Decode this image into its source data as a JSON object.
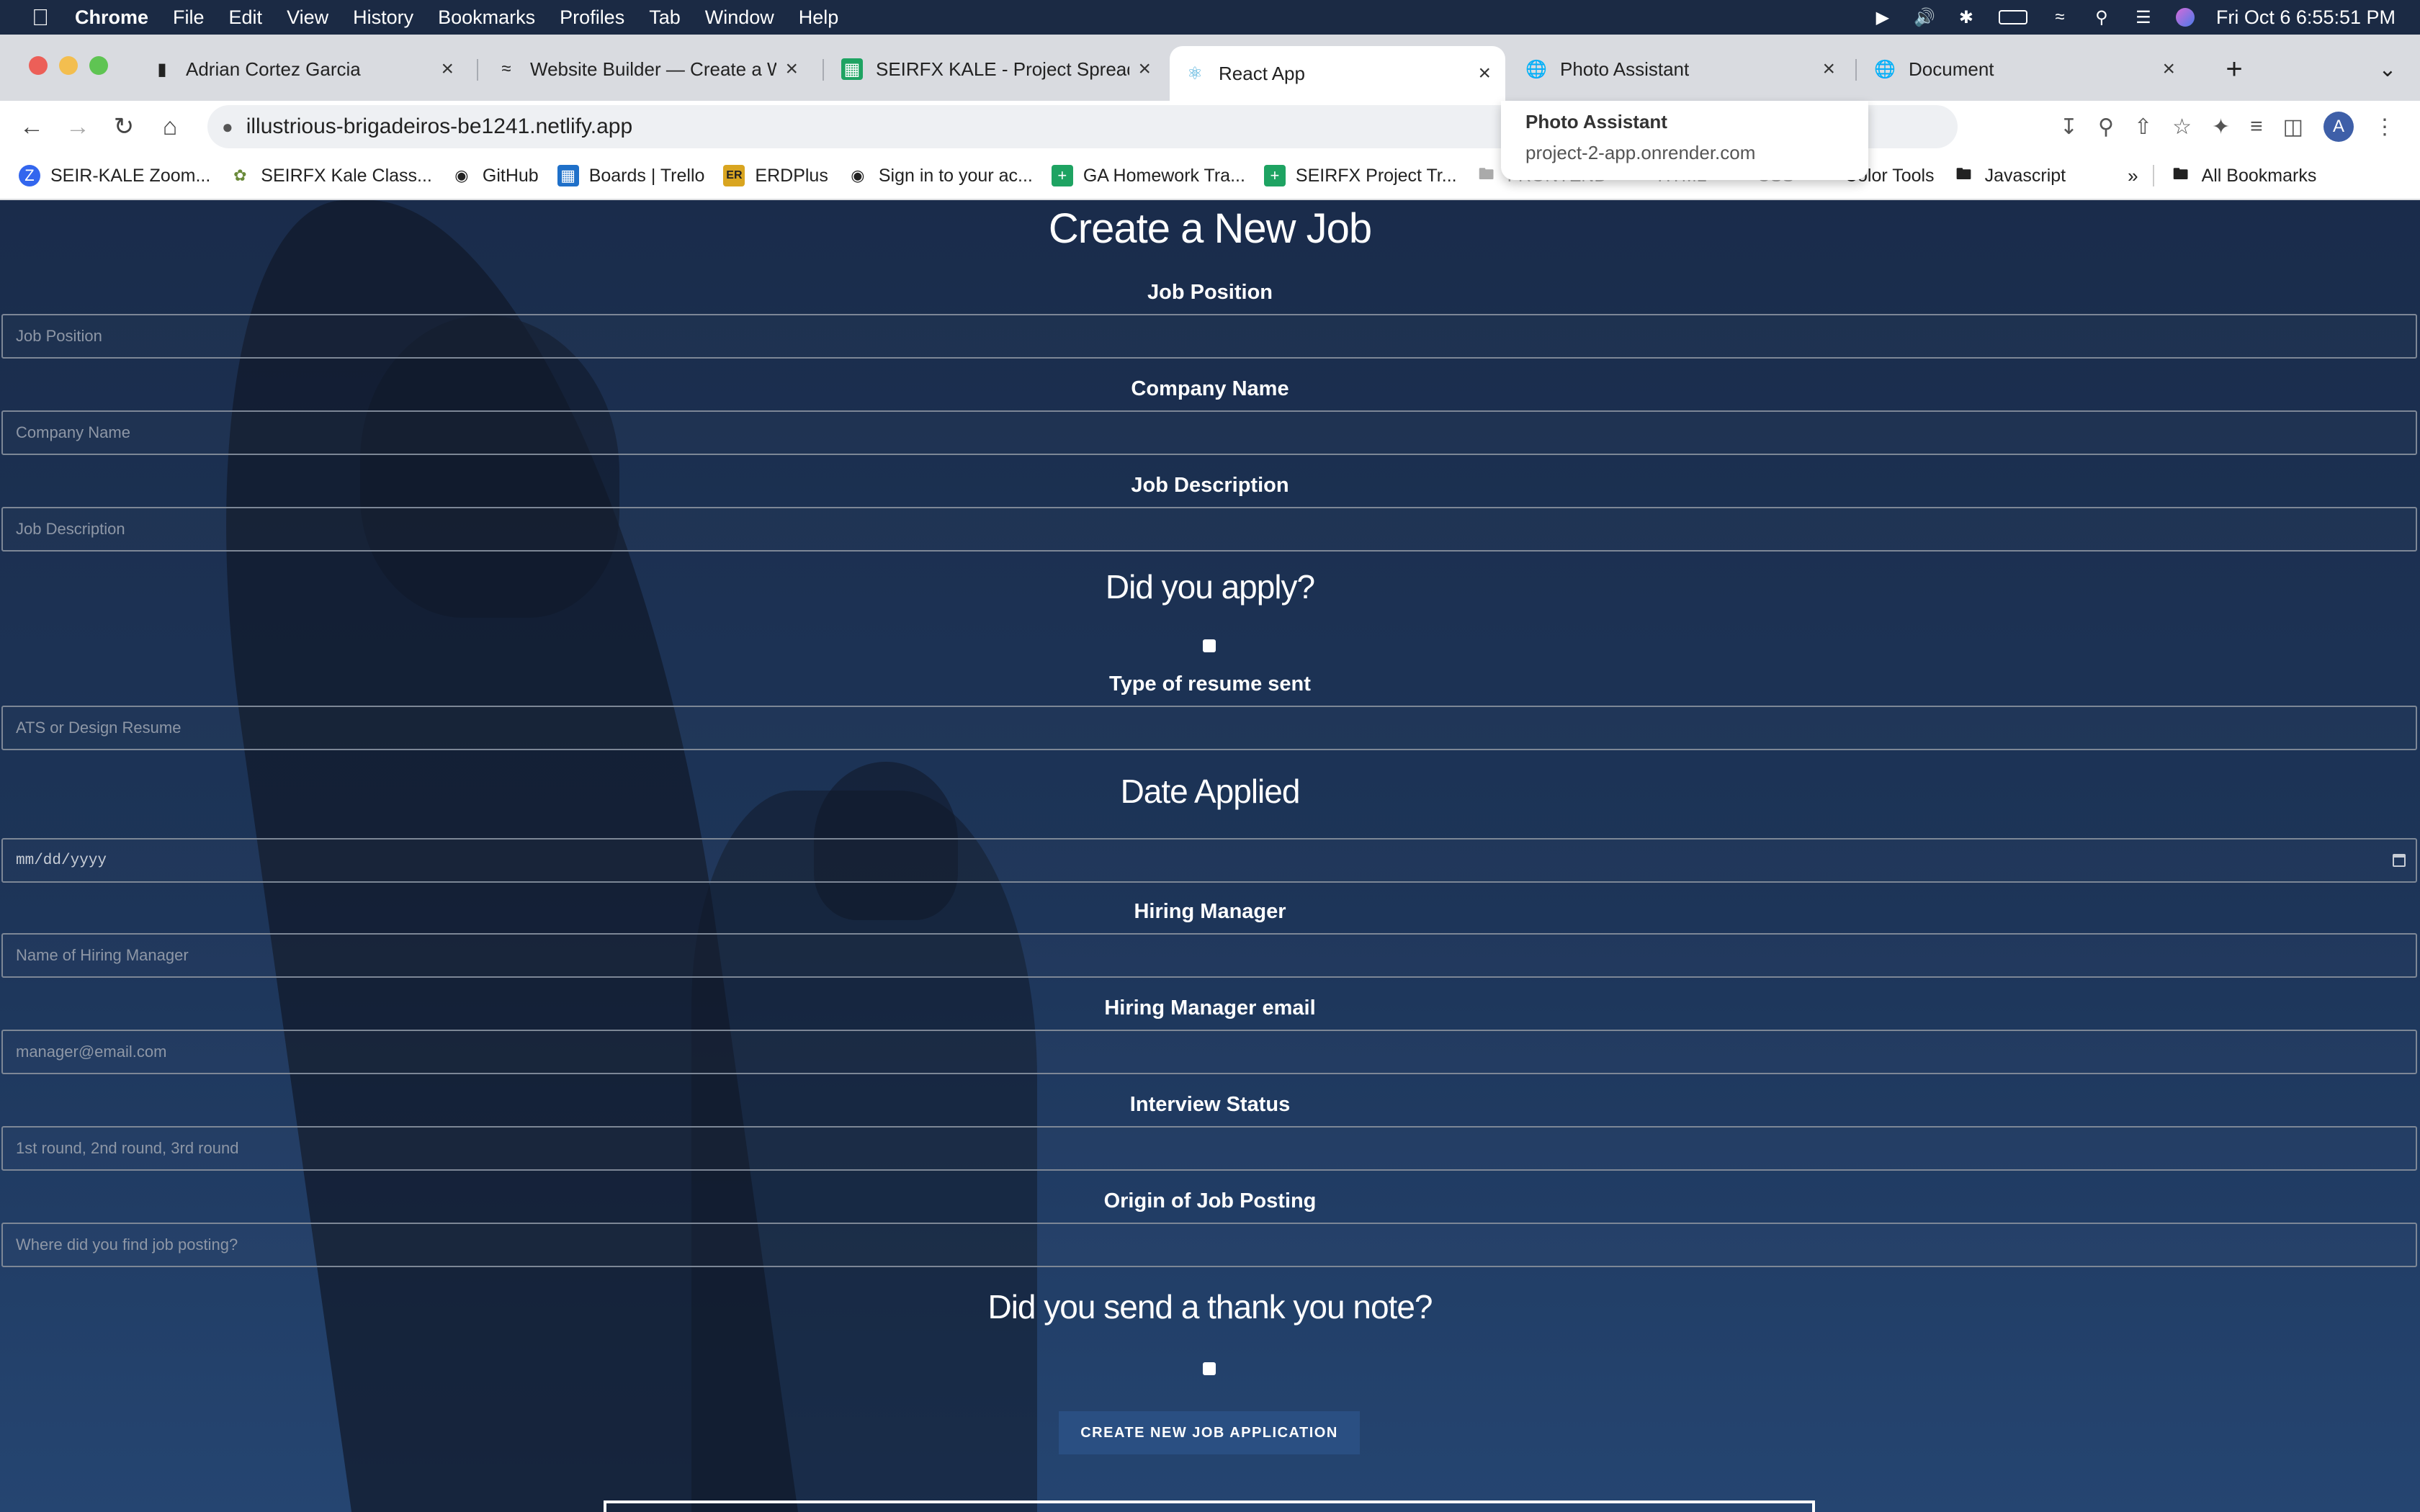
{
  "menubar": {
    "app": "Chrome",
    "items": [
      "File",
      "Edit",
      "View",
      "History",
      "Bookmarks",
      "Profiles",
      "Tab",
      "Window",
      "Help"
    ],
    "clock": "Fri Oct 6  6:55:51 PM"
  },
  "tabs": [
    {
      "title": "Adrian Cortez Garcia",
      "icon": "cube-icon"
    },
    {
      "title": "Website Builder — Create a W",
      "icon": "builder-icon"
    },
    {
      "title": "SEIRFX KALE - Project Spread",
      "icon": "sheets-icon"
    },
    {
      "title": "React App",
      "icon": "react-icon"
    },
    {
      "title": "Photo Assistant",
      "icon": "globe-icon"
    },
    {
      "title": "Document",
      "icon": "globe-icon"
    }
  ],
  "hovercard": {
    "title": "Photo Assistant",
    "url": "project-2-app.onrender.com"
  },
  "address": "illustrious-brigadeiros-be1241.netlify.app",
  "avatar_letter": "A",
  "bookmarks": [
    {
      "label": "SEIR-KALE Zoom...",
      "icon": "zoom-icon",
      "color": "#3366ee"
    },
    {
      "label": "SEIRFX Kale Class...",
      "icon": "plant-icon",
      "color": "#6a8a3a"
    },
    {
      "label": "GitHub",
      "icon": "github-icon",
      "color": "#222222"
    },
    {
      "label": "Boards | Trello",
      "icon": "trello-icon",
      "color": "#1f70c9"
    },
    {
      "label": "ERDPlus",
      "icon": "erd-icon",
      "color": "#d9a520"
    },
    {
      "label": "Sign in to your ac...",
      "icon": "github-icon",
      "color": "#222222"
    },
    {
      "label": "GA Homework Tra...",
      "icon": "sheets-icon",
      "color": "#1ea362"
    },
    {
      "label": "SEIRFX Project Tr...",
      "icon": "sheets-icon",
      "color": "#1ea362"
    },
    {
      "label": "FRONTEND",
      "icon": "folder-icon",
      "color": "#aaaaaa"
    },
    {
      "label": "HTML",
      "icon": "folder-icon",
      "color": "#aaaaaa"
    },
    {
      "label": "CSS",
      "icon": "folder-icon",
      "color": "#aaaaaa"
    },
    {
      "label": "Color Tools",
      "icon": "folder-icon",
      "color": "#555555"
    },
    {
      "label": "Javascript",
      "icon": "folder-icon",
      "color": "#555555"
    }
  ],
  "bookmarks_overflow": "»",
  "all_bookmarks": "All Bookmarks",
  "form": {
    "title": "Create a New Job",
    "job_position": {
      "label": "Job Position",
      "placeholder": "Job Position"
    },
    "company_name": {
      "label": "Company Name",
      "placeholder": "Company Name"
    },
    "job_description": {
      "label": "Job Description",
      "placeholder": "Job Description"
    },
    "applied_heading": "Did you apply?",
    "resume_type": {
      "label": "Type of resume sent",
      "placeholder": "ATS or Design Resume"
    },
    "date_heading": "Date Applied",
    "date_placeholder": "mm/dd/yyyy",
    "hiring_manager": {
      "label": "Hiring Manager",
      "placeholder": "Name of Hiring Manager"
    },
    "hiring_manager_email": {
      "label": "Hiring Manager email",
      "placeholder": "manager@email.com"
    },
    "interview_status": {
      "label": "Interview Status",
      "placeholder": "1st round, 2nd round, 3rd round"
    },
    "origin": {
      "label": "Origin of Job Posting",
      "placeholder": "Where did you find job posting?"
    },
    "thank_you_heading": "Did you send a thank you note?",
    "submit_label": "CREATE NEW JOB APPLICATION"
  }
}
